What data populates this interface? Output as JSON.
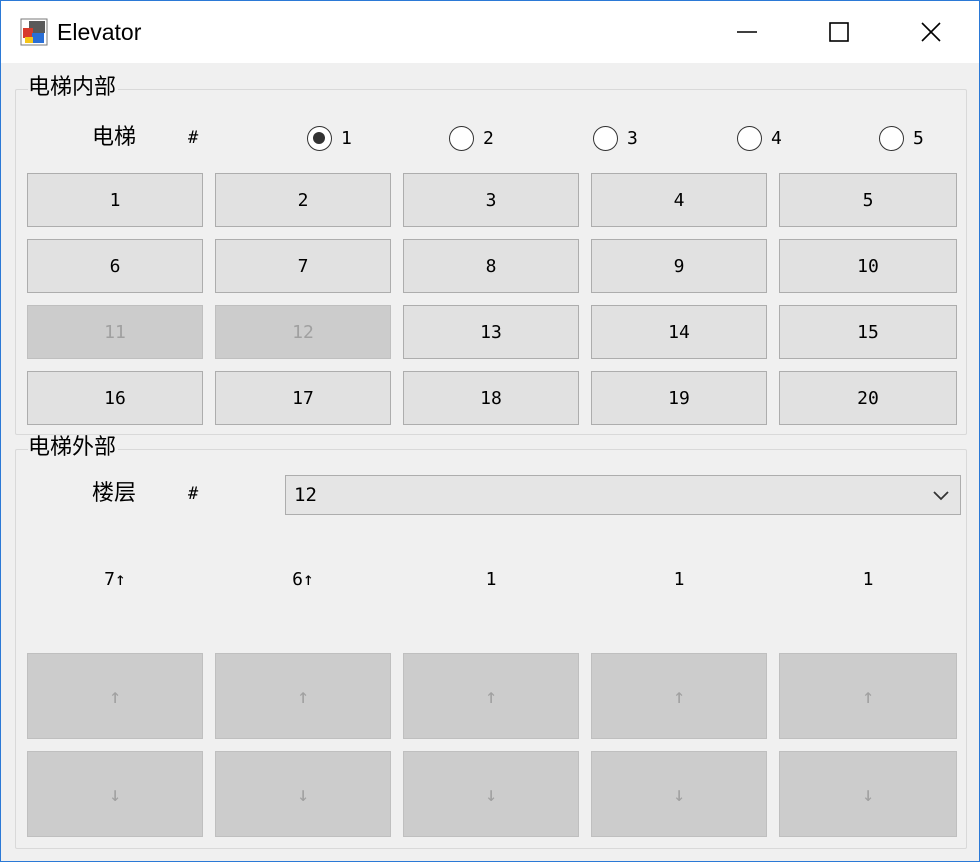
{
  "window": {
    "title": "Elevator"
  },
  "inside": {
    "legend": "电梯内部",
    "label": "电梯",
    "hash": "#",
    "elevators": [
      {
        "label": "1",
        "checked": true
      },
      {
        "label": "2",
        "checked": false
      },
      {
        "label": "3",
        "checked": false
      },
      {
        "label": "4",
        "checked": false
      },
      {
        "label": "5",
        "checked": false
      }
    ],
    "floors": [
      {
        "label": "1",
        "enabled": true
      },
      {
        "label": "2",
        "enabled": true
      },
      {
        "label": "3",
        "enabled": true
      },
      {
        "label": "4",
        "enabled": true
      },
      {
        "label": "5",
        "enabled": true
      },
      {
        "label": "6",
        "enabled": true
      },
      {
        "label": "7",
        "enabled": true
      },
      {
        "label": "8",
        "enabled": true
      },
      {
        "label": "9",
        "enabled": true
      },
      {
        "label": "10",
        "enabled": true
      },
      {
        "label": "11",
        "enabled": false
      },
      {
        "label": "12",
        "enabled": false
      },
      {
        "label": "13",
        "enabled": true
      },
      {
        "label": "14",
        "enabled": true
      },
      {
        "label": "15",
        "enabled": true
      },
      {
        "label": "16",
        "enabled": true
      },
      {
        "label": "17",
        "enabled": true
      },
      {
        "label": "18",
        "enabled": true
      },
      {
        "label": "19",
        "enabled": true
      },
      {
        "label": "20",
        "enabled": true
      }
    ]
  },
  "outside": {
    "legend": "电梯外部",
    "label": "楼层",
    "hash": "#",
    "selected_floor": "12",
    "statuses": [
      "7↑",
      "6↑",
      "1",
      "1",
      "1"
    ],
    "up_label": "↑",
    "down_label": "↓"
  }
}
